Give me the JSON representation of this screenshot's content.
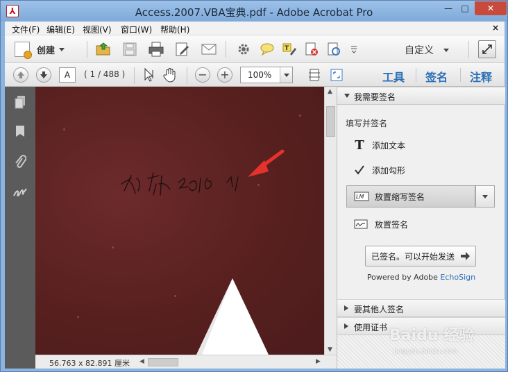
{
  "window": {
    "title": "Access.2007.VBA宝典.pdf - Adobe Acrobat Pro",
    "app_icon": "acrobat-icon",
    "minimize": "—",
    "maximize": "□",
    "close": "✕"
  },
  "menubar": {
    "items": [
      "文件(F)",
      "编辑(E)",
      "视图(V)",
      "窗口(W)",
      "帮助(H)"
    ],
    "close": "×"
  },
  "toolbar": {
    "create_label": "创建",
    "custom_label": "自定义",
    "icons": [
      "open-icon",
      "save-icon",
      "print-icon",
      "edit-icon",
      "email-icon",
      "settings-icon",
      "comment-icon",
      "stamp-icon",
      "secure-icon",
      "pages-icon",
      "more-icon",
      "expand-icon"
    ]
  },
  "navigation": {
    "page_value": "A",
    "page_count": "( 1 / 488 )",
    "zoom": "100%",
    "tabs": [
      "工具",
      "签名",
      "注释"
    ]
  },
  "document": {
    "signature_text": "冯秋 2019",
    "dimensions": "56.763 x 82.891 厘米"
  },
  "sign_panel": {
    "section_main": "我需要签名",
    "fill_label": "填写并签名",
    "add_text": "添加文本",
    "add_check": "添加勾形",
    "place_initials": "放置缩写签名",
    "place_signature": "放置签名",
    "send_button": "已签名。可以开始发送",
    "powered_prefix": "Powered by Adobe ",
    "powered_brand": "EchoSign",
    "section_others": "要其他人签名",
    "section_cert": "使用证书"
  },
  "watermark": {
    "main": "Baidu 经验",
    "sub": "jingyan.baidu.com"
  },
  "colors": {
    "accent_link": "#2a6fb5",
    "document_bg": "#5a2122",
    "annotation_arrow": "#e5332b"
  }
}
